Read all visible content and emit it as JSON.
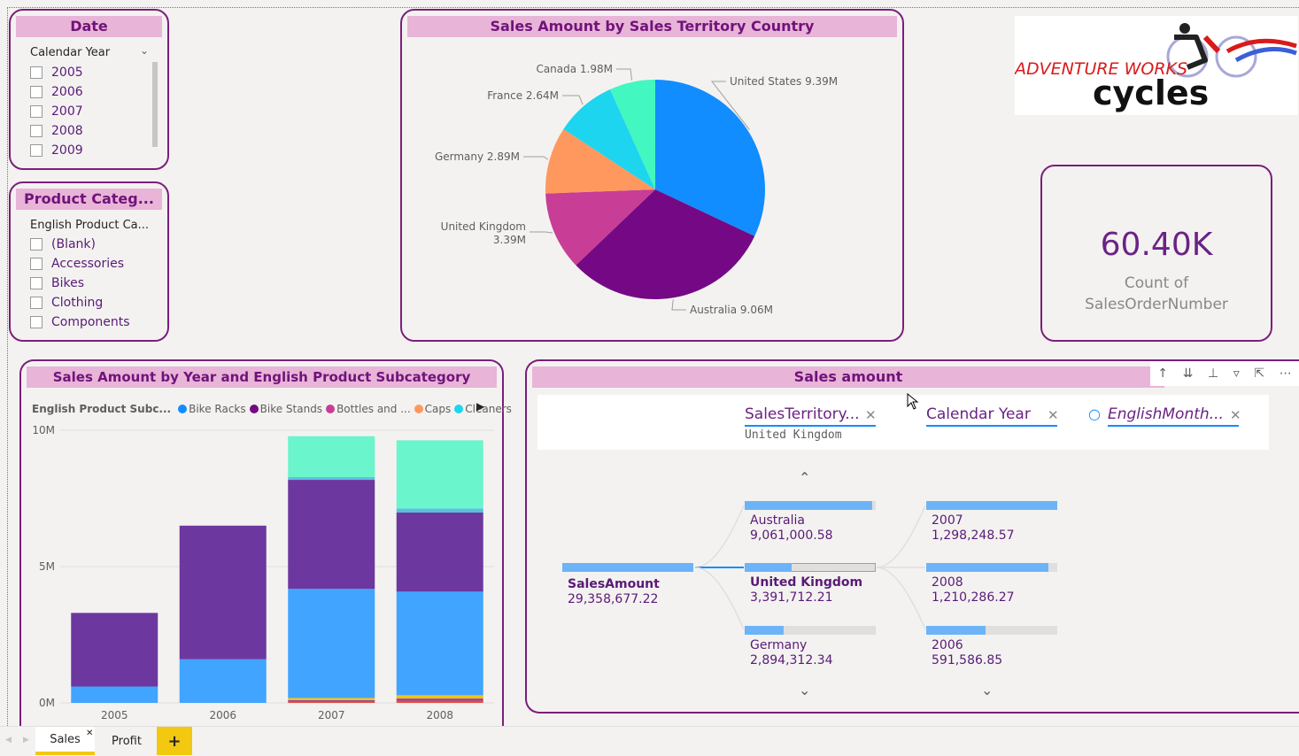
{
  "date_slicer": {
    "title": "Date",
    "header": "Calendar Year",
    "items": [
      "2005",
      "2006",
      "2007",
      "2008",
      "2009"
    ]
  },
  "category_slicer": {
    "title": "Product Categ...",
    "header": "English Product Ca...",
    "items": [
      "(Blank)",
      "Accessories",
      "Bikes",
      "Clothing",
      "Components"
    ]
  },
  "pie_chart": {
    "title": "Sales Amount by Sales Territory Country",
    "chart_data": {
      "type": "pie",
      "title": "Sales Amount by Sales Territory Country",
      "slices": [
        {
          "name": "United States",
          "label": "9.39M",
          "value": 9.39,
          "color": "#118dff"
        },
        {
          "name": "Australia",
          "label": "9.06M",
          "value": 9.06,
          "color": "#750985"
        },
        {
          "name": "United Kingdom",
          "label": "3.39M",
          "value": 3.39,
          "color": "#c83d95"
        },
        {
          "name": "Germany",
          "label": "2.89M",
          "value": 2.89,
          "color": "#ff985e"
        },
        {
          "name": "France",
          "label": "2.64M",
          "value": 2.64,
          "color": "#1dd5ee"
        },
        {
          "name": "Canada",
          "label": "1.98M",
          "value": 1.98,
          "color": "#42f7c0"
        }
      ]
    }
  },
  "kpi": {
    "value": "60.40K",
    "label_line1": "Count of",
    "label_line2": "SalesOrderNumber"
  },
  "bar_chart": {
    "title": "Sales Amount by Year and English Product Subcategory",
    "legend_title": "English Product Subc...",
    "legend": [
      {
        "name": "Bike Racks",
        "color": "#118dff"
      },
      {
        "name": "Bike Stands",
        "color": "#750985"
      },
      {
        "name": "Bottles and ...",
        "color": "#c83d95"
      },
      {
        "name": "Caps",
        "color": "#ff985e"
      },
      {
        "name": "Cleaners",
        "color": "#1dd5ee"
      }
    ],
    "chart_data": {
      "type": "bar",
      "stacked": true,
      "categories": [
        "2005",
        "2006",
        "2007",
        "2008"
      ],
      "y_ticks": [
        "0M",
        "5M",
        "10M"
      ],
      "ylim": [
        0,
        10
      ],
      "series": [
        {
          "color": "#e74c3c",
          "values": [
            0,
            0,
            0.05,
            0.08
          ]
        },
        {
          "color": "#8e44ad",
          "values": [
            0,
            0,
            0.05,
            0.08
          ]
        },
        {
          "color": "#f1c40f",
          "values": [
            0,
            0,
            0.08,
            0.12
          ]
        },
        {
          "color": "#41a4ff",
          "values": [
            0.6,
            1.6,
            4.0,
            3.8
          ]
        },
        {
          "color": "#6c389f",
          "values": [
            2.7,
            4.9,
            4.0,
            2.9
          ]
        },
        {
          "color": "#5bc0de",
          "values": [
            0,
            0,
            0.1,
            0.15
          ]
        },
        {
          "color": "#6bf5cc",
          "values": [
            0,
            0,
            1.5,
            2.5
          ]
        }
      ]
    }
  },
  "decomp_tree": {
    "title": "Sales amount",
    "crumbs": [
      {
        "label": "SalesTerritory...",
        "value": "United Kingdom"
      },
      {
        "label": "Calendar Year",
        "value": ""
      },
      {
        "label": "EnglishMonth...",
        "value": ""
      }
    ],
    "root": {
      "name": "SalesAmount",
      "value": "29,358,677.22"
    },
    "level1": [
      {
        "name": "Australia",
        "value": "9,061,000.58",
        "fraction": 0.97
      },
      {
        "name": "United Kingdom",
        "value": "3,391,712.21",
        "fraction": 0.36
      },
      {
        "name": "Germany",
        "value": "2,894,312.34",
        "fraction": 0.3
      }
    ],
    "level2": [
      {
        "name": "2007",
        "value": "1,298,248.57",
        "fraction": 1.0
      },
      {
        "name": "2008",
        "value": "1,210,286.27",
        "fraction": 0.93
      },
      {
        "name": "2006",
        "value": "591,586.85",
        "fraction": 0.45
      }
    ]
  },
  "tabs": {
    "sales": "Sales",
    "profit": "Profit",
    "add": "+"
  },
  "logo": {
    "line1": "ADVENTURE WORKS",
    "line2": "cycles"
  }
}
